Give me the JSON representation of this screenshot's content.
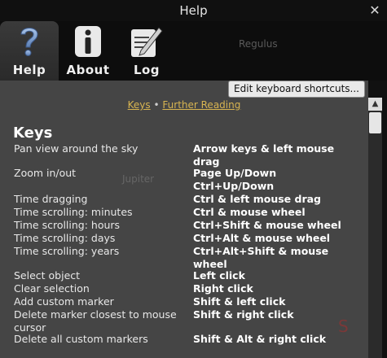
{
  "window": {
    "title": "Help",
    "close_glyph": "✕"
  },
  "tabs": [
    {
      "label": "Help",
      "icon": "question-icon",
      "active": true
    },
    {
      "label": "About",
      "icon": "info-icon",
      "active": false
    },
    {
      "label": "Log",
      "icon": "log-pencil-icon",
      "active": false
    }
  ],
  "background_labels": {
    "regulus": "Regulus",
    "jupiter": "Jupiter"
  },
  "toolbar": {
    "edit_shortcuts_label": "Edit keyboard shortcuts..."
  },
  "links": {
    "keys": "Keys",
    "separator": "•",
    "further_reading": "Further Reading"
  },
  "section": {
    "title": "Keys"
  },
  "shortcuts": [
    {
      "desc": "Pan view around the sky",
      "keys": "Arrow keys & left mouse drag"
    },
    {
      "desc": "Zoom in/out",
      "keys": "Page Up/Down"
    },
    {
      "desc": "",
      "keys": "Ctrl+Up/Down"
    },
    {
      "desc": "Time dragging",
      "keys": "Ctrl & left mouse drag"
    },
    {
      "desc": "Time scrolling: minutes",
      "keys": "Ctrl & mouse wheel"
    },
    {
      "desc": "Time scrolling: hours",
      "keys": "Ctrl+Shift & mouse wheel"
    },
    {
      "desc": "Time scrolling: days",
      "keys": "Ctrl+Alt & mouse wheel"
    },
    {
      "desc": "Time scrolling: years",
      "keys": "Ctrl+Alt+Shift & mouse wheel"
    },
    {
      "desc": "Select object",
      "keys": "Left click"
    },
    {
      "desc": "Clear selection",
      "keys": "Right click"
    },
    {
      "desc": "Add custom marker",
      "keys": "Shift & left click"
    },
    {
      "desc": "Delete marker closest to mouse cursor",
      "keys": "Shift & right click"
    },
    {
      "desc": "Delete all custom markers",
      "keys": "Shift & Alt & right click"
    }
  ],
  "colors": {
    "link": "#d7b451",
    "content_bg": "#454545",
    "titlebar_bg": "#101010"
  }
}
